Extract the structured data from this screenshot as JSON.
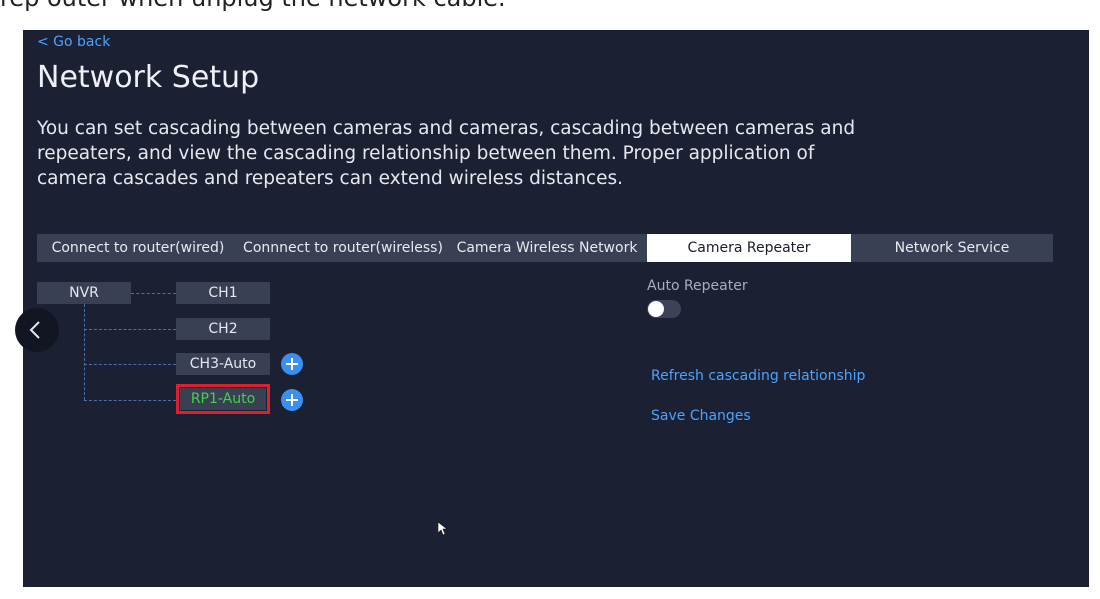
{
  "top_caption": "rep outer when unplug the network cable.",
  "header": {
    "back_label": "< Go back",
    "title": "Network Setup",
    "description": "You can set cascading between cameras and cameras, cascading between cameras and repeaters, and view the cascading relationship between them. Proper application of camera cascades and repeaters can extend wireless distances."
  },
  "tabs": [
    {
      "label": "Connect to router(wired)",
      "active": false
    },
    {
      "label": "Connnect to router(wireless)",
      "active": false
    },
    {
      "label": "Camera Wireless Network",
      "active": false
    },
    {
      "label": "Camera Repeater",
      "active": true
    },
    {
      "label": "Network Service",
      "active": false
    }
  ],
  "topology": {
    "root": "NVR",
    "nodes": [
      "CH1",
      "CH2",
      "CH3-Auto",
      "RP1-Auto"
    ]
  },
  "settings": {
    "auto_repeater_label": "Auto Repeater",
    "auto_repeater_enabled": false,
    "refresh_label": "Refresh cascading relationship",
    "save_label": "Save Changes"
  },
  "colors": {
    "background": "#1c2033",
    "accent": "#4aa3ff",
    "highlight_text": "#3fd34a",
    "highlight_border": "#d8232f"
  }
}
